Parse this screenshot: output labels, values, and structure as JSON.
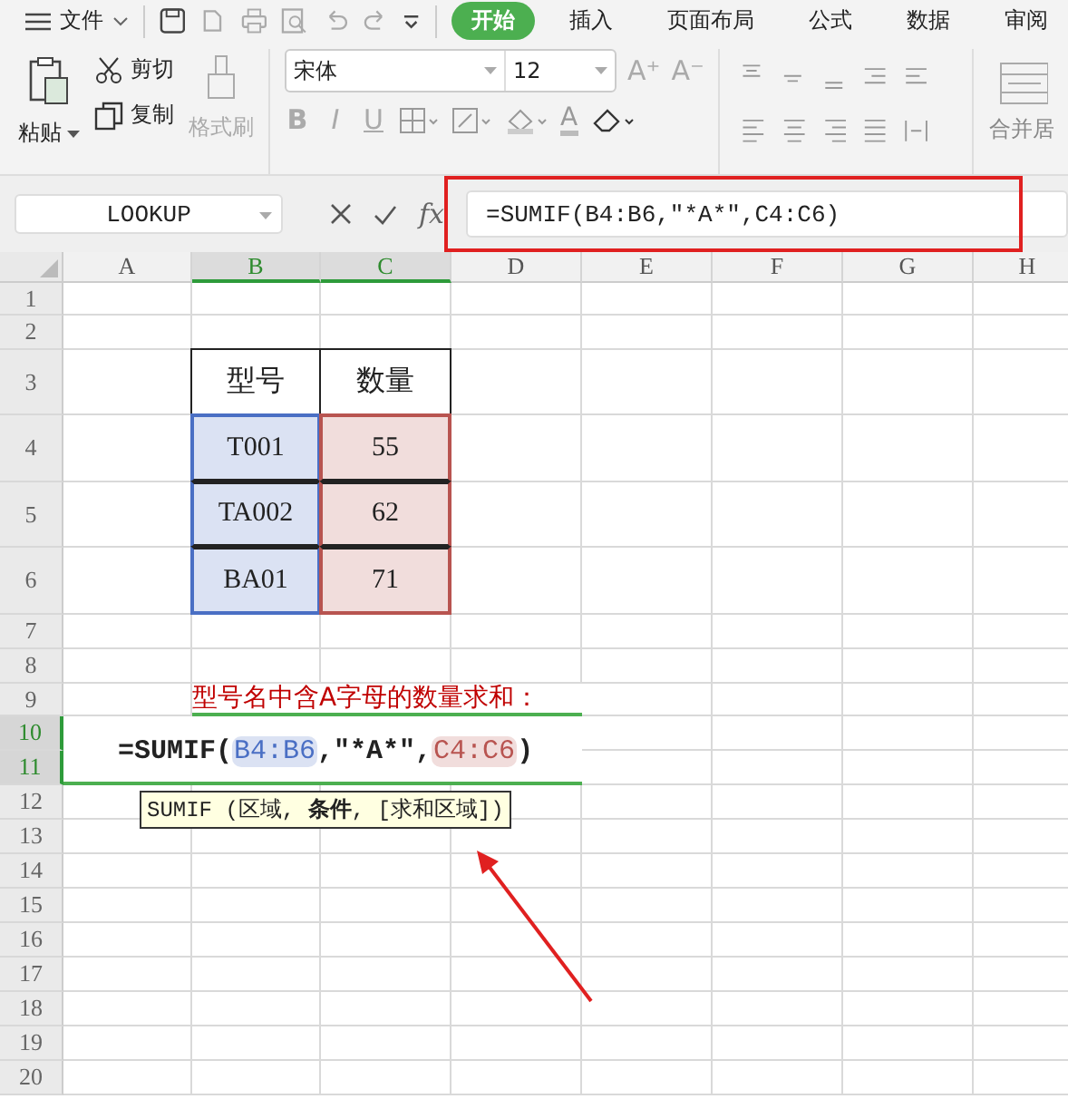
{
  "menu": {
    "label": "文件"
  },
  "tabs": [
    {
      "label": "开始",
      "selected": true
    },
    {
      "label": "插入",
      "selected": false
    },
    {
      "label": "页面布局",
      "selected": false
    },
    {
      "label": "公式",
      "selected": false
    },
    {
      "label": "数据",
      "selected": false
    },
    {
      "label": "审阅",
      "selected": false
    }
  ],
  "clipboard": {
    "paste": "粘贴",
    "cut": "剪切",
    "copy": "复制",
    "format_painter": {
      "label": "格式刷",
      "disabled": true
    }
  },
  "font": {
    "family": "宋体",
    "size": "12",
    "grow": "A⁺",
    "shrink": "A⁻",
    "styles": [
      "B",
      "I",
      "U"
    ],
    "color_button": "A"
  },
  "merge_label": "合并居",
  "name_box": "LOOKUP",
  "fx": "fx",
  "formula": "=SUMIF(B4:B6,″*A*″,C4:C6)",
  "columns": [
    {
      "label": "A",
      "selected": false
    },
    {
      "label": "B",
      "selected": true
    },
    {
      "label": "C",
      "selected": true
    },
    {
      "label": "D",
      "selected": false
    },
    {
      "label": "E",
      "selected": false
    },
    {
      "label": "F",
      "selected": false
    },
    {
      "label": "G",
      "selected": false
    },
    {
      "label": "H",
      "selected": false
    }
  ],
  "rows": [
    {
      "label": "1",
      "selected": false
    },
    {
      "label": "2",
      "selected": false
    },
    {
      "label": "3",
      "selected": false
    },
    {
      "label": "4",
      "selected": false
    },
    {
      "label": "5",
      "selected": false
    },
    {
      "label": "6",
      "selected": false
    },
    {
      "label": "7",
      "selected": false
    },
    {
      "label": "8",
      "selected": false
    },
    {
      "label": "9",
      "selected": false
    },
    {
      "label": "10",
      "selected": true
    },
    {
      "label": "11",
      "selected": true
    },
    {
      "label": "12",
      "selected": false
    },
    {
      "label": "13",
      "selected": false
    },
    {
      "label": "14",
      "selected": false
    },
    {
      "label": "15",
      "selected": false
    },
    {
      "label": "16",
      "selected": false
    },
    {
      "label": "17",
      "selected": false
    },
    {
      "label": "18",
      "selected": false
    },
    {
      "label": "19",
      "selected": false
    },
    {
      "label": "20",
      "selected": false
    }
  ],
  "table": {
    "columns": [
      {
        "header": "型号",
        "color": "#4a6fc4"
      },
      {
        "header": "数量",
        "color": "#b85450"
      }
    ],
    "rows": [
      [
        "T001",
        "55"
      ],
      [
        "TA002",
        "62"
      ],
      [
        "BA01",
        "71"
      ]
    ]
  },
  "note": "型号名中含A字母的数量求和：",
  "cell_formula": [
    {
      "kind": "text",
      "text": "=SUMIF("
    },
    {
      "kind": "ref",
      "text": "B4:B6",
      "color": "#4a6fc4"
    },
    {
      "kind": "text",
      "text": ",″*A*″,"
    },
    {
      "kind": "ref",
      "text": "C4:C6",
      "color": "#b85450"
    },
    {
      "kind": "text",
      "text": ")"
    }
  ],
  "tooltip": "SUMIF (区域, **条件**, [求和区域])"
}
